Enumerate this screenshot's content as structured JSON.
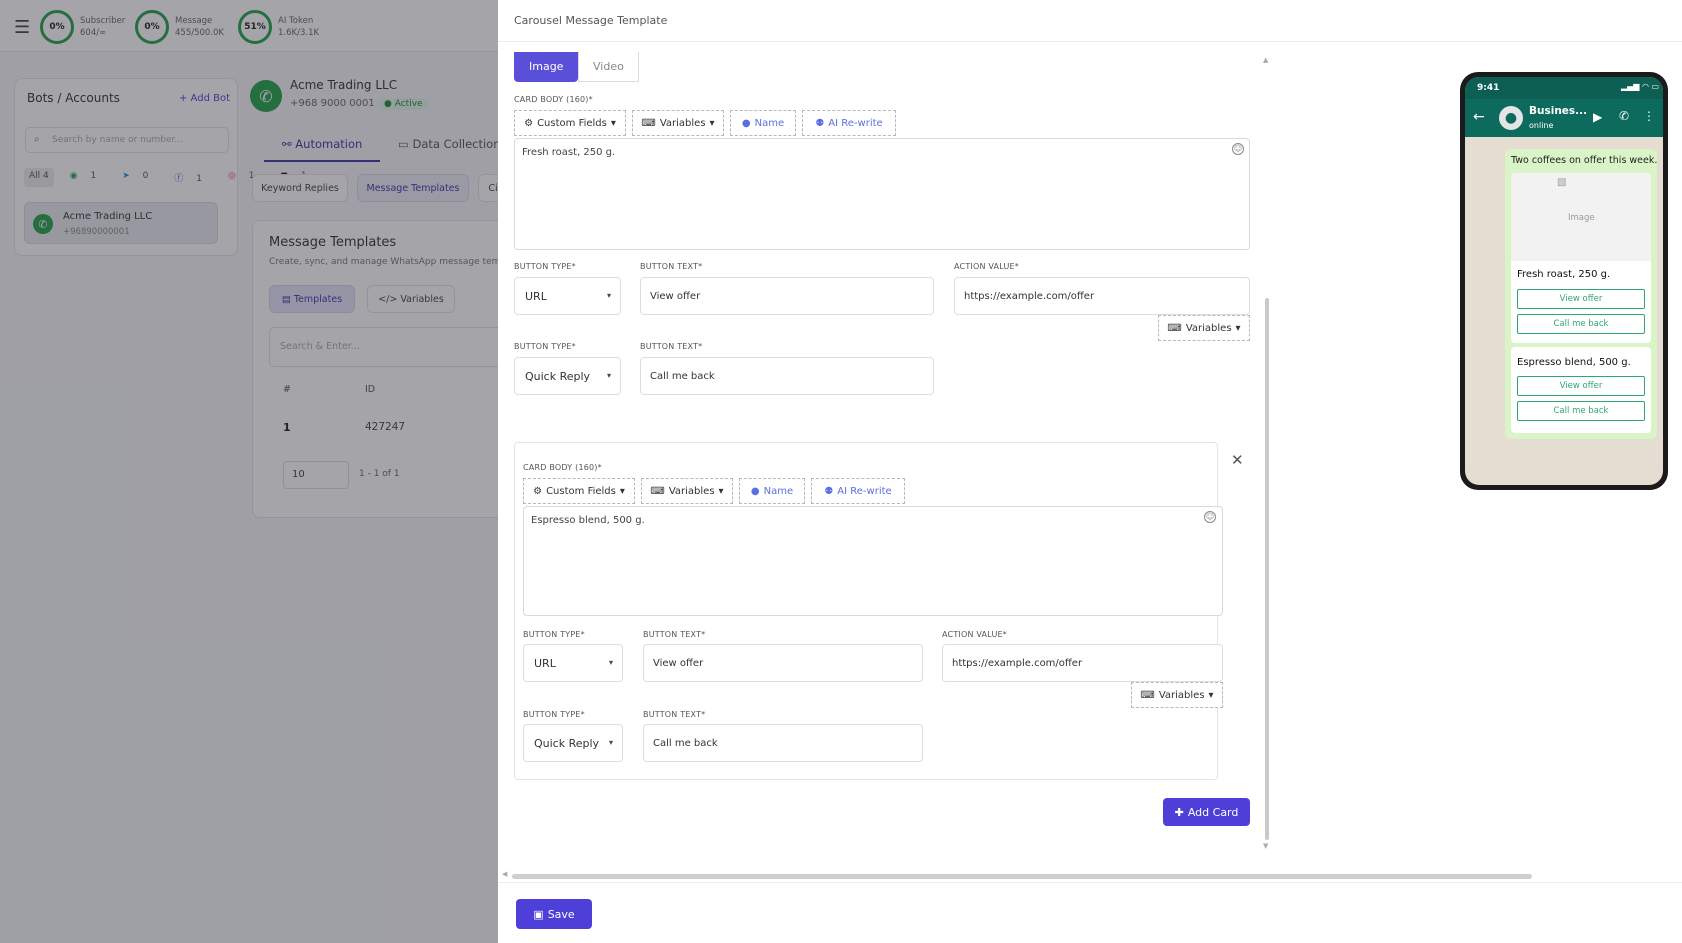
{
  "topbar": {
    "stats": [
      {
        "percent": "0%",
        "label": "Subscriber",
        "value": "604/∞"
      },
      {
        "percent": "0%",
        "label": "Message",
        "value": "455/500.0K"
      },
      {
        "percent": "51%",
        "label": "AI Token",
        "value": "1.6K/3.1K"
      }
    ]
  },
  "sidebar": {
    "title": "Bots / Accounts",
    "add_bot": "+ Add Bot",
    "search_placeholder": "Search by name or number...",
    "platforms": [
      "All 4",
      "1",
      "0",
      "1",
      "1",
      "1"
    ],
    "bot_name": "Acme Trading LLC",
    "bot_phone": "+96890000001"
  },
  "account": {
    "name": "Acme Trading LLC",
    "phone": "+968 9000 0001",
    "status": "Active",
    "tabs": [
      "Automation",
      "Data Collection"
    ],
    "subtabs": [
      "Keyword Replies",
      "Message Templates",
      "Ci"
    ],
    "section_title": "Message Templates",
    "section_desc": "Create, sync, and manage WhatsApp message template",
    "view_tabs": [
      "Templates",
      "Variables"
    ],
    "search_placeholder": "Search & Enter...",
    "table_headers": [
      "#",
      "ID"
    ],
    "row": {
      "num": "1",
      "id": "427247"
    },
    "page_size": "10",
    "pagination": "1 - 1 of 1"
  },
  "modal": {
    "title": "Carousel Message Template",
    "media_tabs": [
      "Image",
      "Video"
    ],
    "card_body_label": "CARD BODY (160)*",
    "toolbar": {
      "custom_fields": "Custom Fields",
      "variables": "Variables",
      "name": "Name",
      "ai_rewrite": "AI Re-write"
    },
    "button_type_label": "BUTTON TYPE*",
    "button_text_label": "BUTTON TEXT*",
    "action_value_label": "ACTION VALUE*",
    "variables_btn": "Variables",
    "cards": [
      {
        "body": "Fresh roast, 250 g.",
        "btn1_type": "URL",
        "btn1_text": "View offer",
        "btn1_action": "https://example.com/offer",
        "btn2_type": "Quick Reply",
        "btn2_text": "Call me back"
      },
      {
        "body": "Espresso blend, 500 g.",
        "btn1_type": "URL",
        "btn1_text": "View offer",
        "btn1_action": "https://example.com/offer",
        "btn2_type": "Quick Reply",
        "btn2_text": "Call me back"
      }
    ],
    "add_card": "Add Card",
    "save": "Save"
  },
  "preview": {
    "time": "9:41",
    "contact": "Busines...",
    "contact_status": "online",
    "message": "Two coffees on offer this week.",
    "image_placeholder": "Image",
    "cards": [
      {
        "title": "Fresh roast, 250 g.",
        "btn1": "View offer",
        "btn2": "Call me back"
      },
      {
        "title": "Espresso blend, 500 g.",
        "btn1": "View offer",
        "btn2": "Call me back"
      }
    ]
  },
  "colors": {
    "accent": "#4f3fd9",
    "whatsapp": "#0d6b5e",
    "success": "#22a04b"
  }
}
